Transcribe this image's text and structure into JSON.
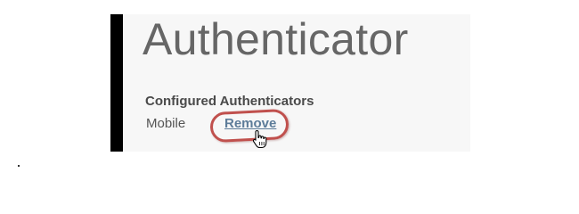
{
  "page": {
    "title": "Authenticator"
  },
  "authenticators": {
    "heading": "Configured Authenticators",
    "items": [
      {
        "name": "Mobile",
        "action_label": "Remove"
      }
    ]
  },
  "colors": {
    "accent_bar": "#000000",
    "title_text": "#666666",
    "link": "#5d7c99",
    "highlight_ring": "#c0504d",
    "panel_background": "#f7f7f7"
  },
  "icons": {
    "cursor": "hand-pointer-icon"
  }
}
